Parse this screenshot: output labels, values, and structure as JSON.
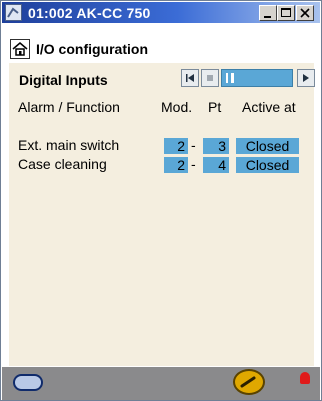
{
  "window": {
    "title": "01:002 AK-CC 750"
  },
  "header": {
    "title": "I/O configuration"
  },
  "section": {
    "label": "Digital Inputs"
  },
  "table": {
    "columns": [
      "Alarm / Function",
      "Mod.",
      "Pt",
      "Active at"
    ],
    "rows": [
      {
        "function": "Ext. main switch",
        "mod": "2",
        "sep": "-",
        "pt": "3",
        "active_at": "Closed"
      },
      {
        "function": "Case cleaning",
        "mod": "2",
        "sep": "-",
        "pt": "4",
        "active_at": "Closed"
      }
    ]
  },
  "colors": {
    "accent": "#5aa7d6",
    "panel": "#f4eedf",
    "titlebar": "#1e3f9b",
    "footer": "#8a8a8c"
  },
  "icons": {
    "title": "app-icon",
    "home": "home-icon",
    "first": "first-page-icon",
    "prev": "prev-page-icon",
    "next": "next-page-icon",
    "footer_left": "module-icon",
    "footer_tool": "wrench-icon",
    "footer_alarm": "alarm-bell-icon"
  }
}
